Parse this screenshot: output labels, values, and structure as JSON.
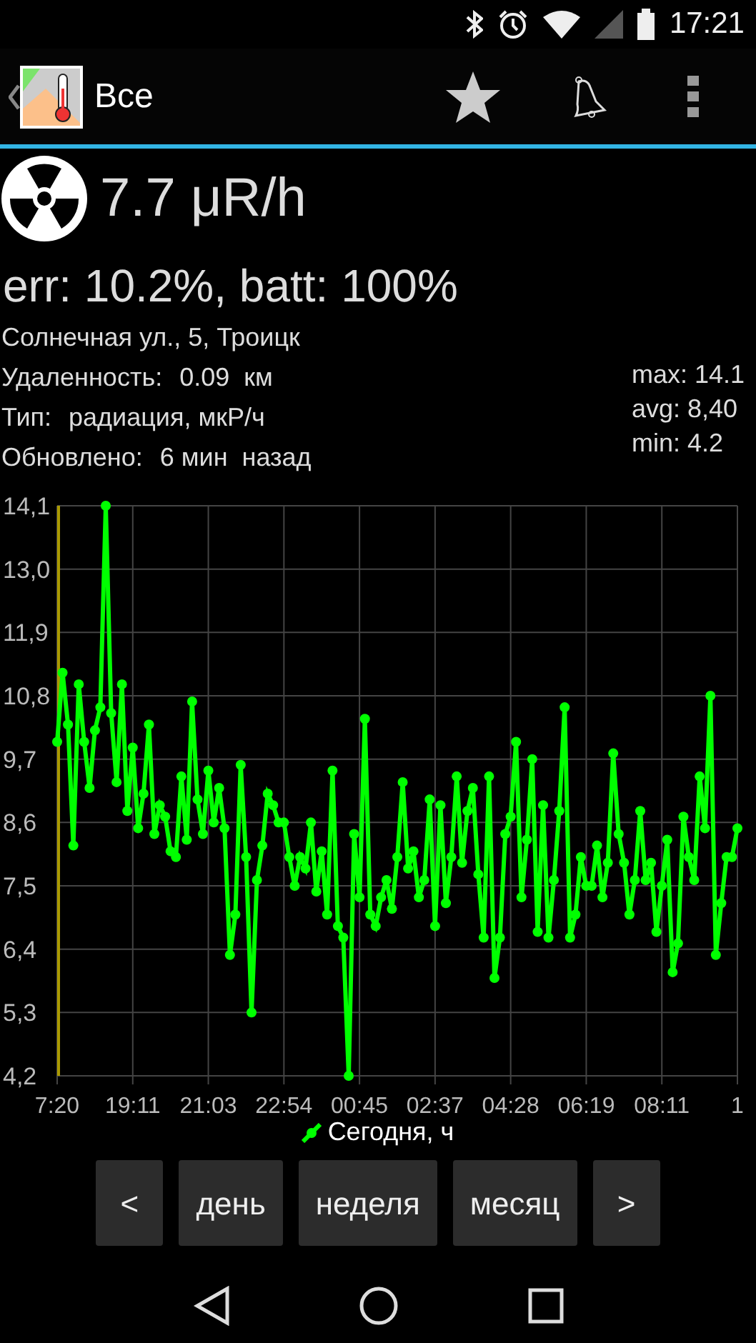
{
  "status_bar": {
    "time": "17:21"
  },
  "action_bar": {
    "title": "Все"
  },
  "reading": {
    "value": "7.7 μR/h",
    "details": "err: 10.2%, batt: 100%"
  },
  "info": {
    "address": "Солнечная ул., 5, Троицк",
    "rows": [
      {
        "label": "Удаленность:",
        "value": "0.09  км"
      },
      {
        "label": "Тип:",
        "value": "радиация, мкР/ч"
      },
      {
        "label": "Обновлено:",
        "value": "6 мин  назад"
      }
    ]
  },
  "stats": [
    "max: 14.1",
    "avg: 8,40",
    "min: 4.2"
  ],
  "chart_data": {
    "type": "line",
    "grid": true,
    "ylim": [
      4.2,
      14.1
    ],
    "categories": [
      "7:20",
      null,
      null,
      null,
      null,
      null,
      null,
      null,
      null,
      null,
      null,
      null,
      null,
      null,
      "19:11",
      null,
      null,
      null,
      null,
      null,
      null,
      null,
      null,
      null,
      null,
      null,
      null,
      null,
      "21:03",
      null,
      null,
      null,
      null,
      null,
      null,
      null,
      null,
      null,
      null,
      null,
      null,
      null,
      "22:54",
      null,
      null,
      null,
      null,
      null,
      null,
      null,
      null,
      null,
      null,
      null,
      null,
      null,
      "00:45",
      null,
      null,
      null,
      null,
      null,
      null,
      null,
      null,
      null,
      null,
      null,
      null,
      null,
      "02:37",
      null,
      null,
      null,
      null,
      null,
      null,
      null,
      null,
      null,
      null,
      null,
      null,
      null,
      "04:28",
      null,
      null,
      null,
      null,
      null,
      null,
      null,
      null,
      null,
      null,
      null,
      null,
      null,
      "06:19",
      null,
      null,
      null,
      null,
      null,
      null,
      null,
      null,
      null,
      null,
      null,
      null,
      null,
      "08:11",
      null,
      null,
      null,
      null,
      null,
      null,
      null,
      null,
      null,
      null,
      null,
      null,
      null,
      "1"
    ],
    "yticks": [
      {
        "value": 4.2,
        "label": "4,2"
      },
      {
        "value": 5.3,
        "label": "5,3"
      },
      {
        "value": 6.4,
        "label": "6,4"
      },
      {
        "value": 7.5,
        "label": "7,5"
      },
      {
        "value": 8.6,
        "label": "8,6"
      },
      {
        "value": 9.7,
        "label": "9,7"
      },
      {
        "value": 10.8,
        "label": "10,8"
      },
      {
        "value": 11.9,
        "label": "11,9"
      },
      {
        "value": 13.0,
        "label": "13,0"
      },
      {
        "value": 14.1,
        "label": "14,1"
      }
    ],
    "series": [
      {
        "name": "Сегодня, ч",
        "color": "#00ff00",
        "marker": "circle",
        "values": [
          10.0,
          11.2,
          10.3,
          8.2,
          11.0,
          10.0,
          9.2,
          10.2,
          10.6,
          14.1,
          10.5,
          9.3,
          11.0,
          8.8,
          9.9,
          8.5,
          9.1,
          10.3,
          8.4,
          8.9,
          8.7,
          8.1,
          8.0,
          9.4,
          8.3,
          10.7,
          9.0,
          8.4,
          9.5,
          8.6,
          9.2,
          8.5,
          6.3,
          7.0,
          9.6,
          8.0,
          5.3,
          7.6,
          8.2,
          9.1,
          8.9,
          8.6,
          8.6,
          8.0,
          7.5,
          8.0,
          7.8,
          8.6,
          7.4,
          8.1,
          7.0,
          9.5,
          6.8,
          6.6,
          4.2,
          8.4,
          7.3,
          10.4,
          7.0,
          6.8,
          7.3,
          7.6,
          7.1,
          8.0,
          9.3,
          7.8,
          8.1,
          7.3,
          7.6,
          9.0,
          6.8,
          8.9,
          7.2,
          8.0,
          9.4,
          7.9,
          8.8,
          9.2,
          7.7,
          6.6,
          9.4,
          5.9,
          6.6,
          8.4,
          8.7,
          10.0,
          7.3,
          8.3,
          9.7,
          6.7,
          8.9,
          6.6,
          7.6,
          8.8,
          10.6,
          6.6,
          7.0,
          8.0,
          7.5,
          7.5,
          8.2,
          7.3,
          7.9,
          9.8,
          8.4,
          7.9,
          7.0,
          7.6,
          8.8,
          7.6,
          7.9,
          6.7,
          7.5,
          8.3,
          6.0,
          6.5,
          8.7,
          8.0,
          7.6,
          9.4,
          8.5,
          10.8,
          6.3,
          7.2,
          8.0,
          8.0,
          8.5
        ]
      }
    ]
  },
  "buttons": [
    "<",
    "день",
    "неделя",
    "месяц",
    ">"
  ]
}
